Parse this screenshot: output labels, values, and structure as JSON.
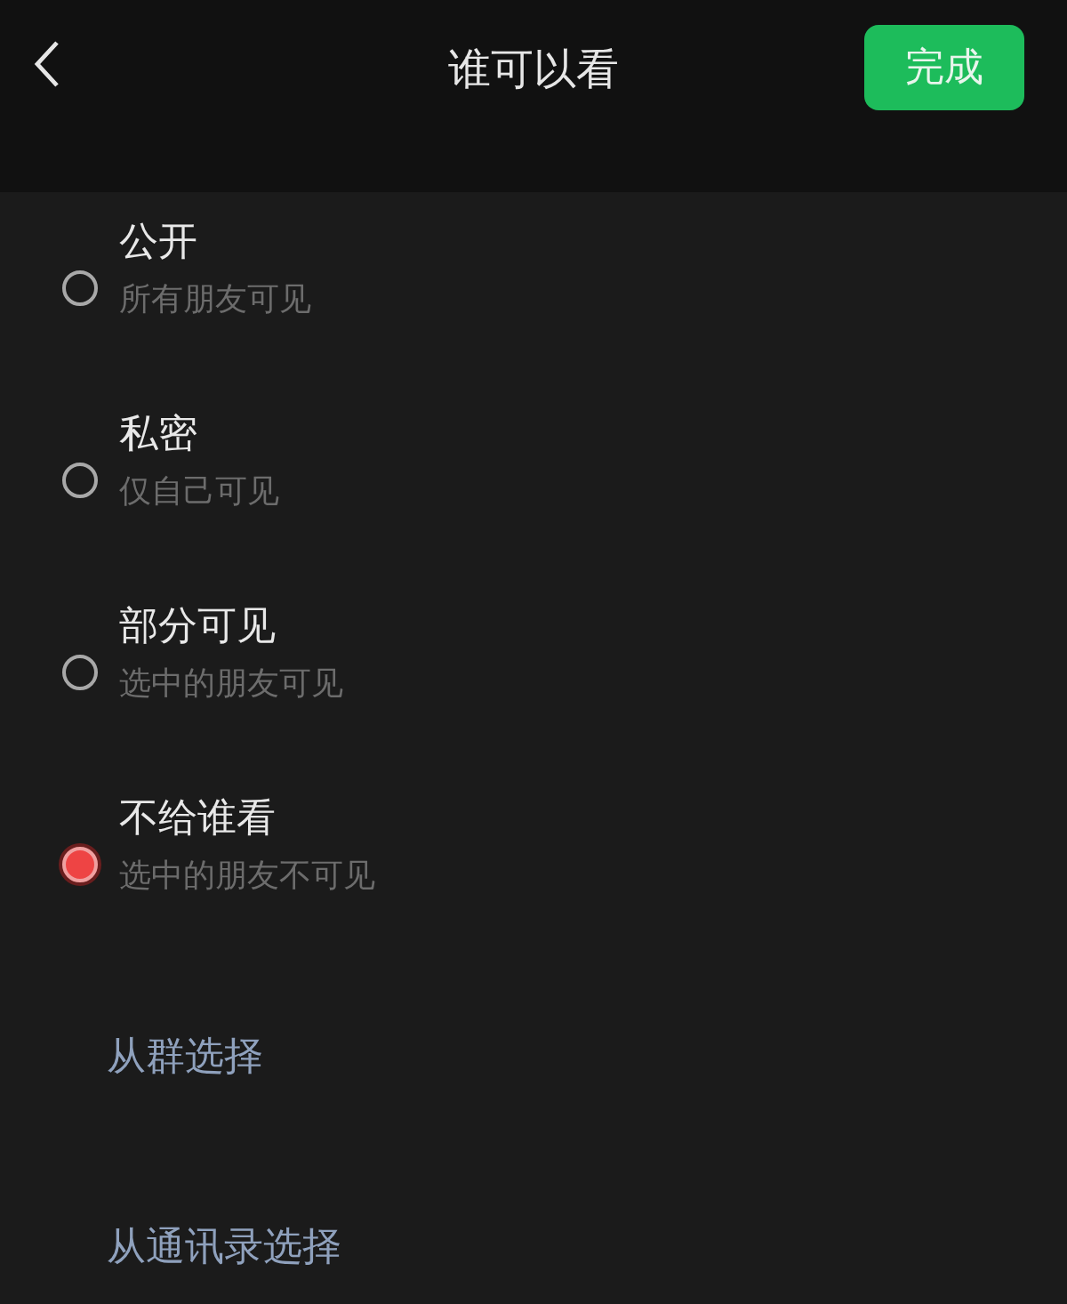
{
  "header": {
    "title": "谁可以看",
    "done_button": "完成"
  },
  "options": [
    {
      "title": "公开",
      "subtitle": "所有朋友可见",
      "selected": false
    },
    {
      "title": "私密",
      "subtitle": "仅自己可见",
      "selected": false
    },
    {
      "title": "部分可见",
      "subtitle": "选中的朋友可见",
      "selected": false
    },
    {
      "title": "不给谁看",
      "subtitle": "选中的朋友不可见",
      "selected": true
    }
  ],
  "links": [
    "从群选择",
    "从通讯录选择"
  ]
}
